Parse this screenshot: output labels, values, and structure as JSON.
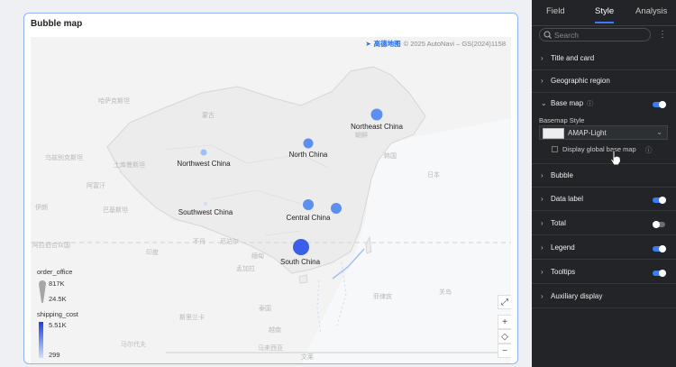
{
  "card": {
    "title": "Bubble map"
  },
  "map": {
    "credit_logo": "高德地图",
    "credit_text": "© 2025 AutoNavi – GS(2024)1158",
    "places": [
      "哈萨克斯坦",
      "哈萨克",
      "乌兹别克斯坦",
      "土库曼斯坦",
      "阿富汗",
      "伊朗",
      "巴基斯坦",
      "印度",
      "孟加拉",
      "巴勒",
      "阿拉伯合众国",
      "斯里兰卡",
      "马尔代夫",
      "蒙古",
      "朝鲜",
      "韩国",
      "日本",
      "菲律宾",
      "关岛",
      "马来西亚",
      "印度尼西亚",
      "越南",
      "泰国",
      "缅甸",
      "柬",
      "印",
      "文莱",
      "新加坡",
      "尼泊尔",
      "不丹",
      "中国台湾"
    ],
    "bubbles": [
      {
        "label": "Northeast China",
        "value": "",
        "color": "#5b8ff0"
      },
      {
        "label": "North China",
        "value": "",
        "color": "#5b8ff0"
      },
      {
        "label": "Northwest China",
        "value": "",
        "color": "#9fc0f6"
      },
      {
        "label": "Southwest China",
        "value": "",
        "color": "#cfe0fb"
      },
      {
        "label": "Central China",
        "value": "",
        "color": "#5b8ff0"
      },
      {
        "label": "South China",
        "value": "",
        "color": "#3b5fe6"
      }
    ],
    "legend": {
      "size_title": "order_office",
      "size_max": "817K",
      "size_min": "24.5K",
      "color_title": "shipping_cost",
      "color_max": "5.51K",
      "color_min": "299",
      "color_high": "#1d3fe0",
      "color_low": "#cfe0fb"
    }
  },
  "panel": {
    "tabs": [
      "Field",
      "Style",
      "Analysis"
    ],
    "active_tab": "Style",
    "search_placeholder": "Search",
    "sections": {
      "title_card": "Title and card",
      "geo_region": "Geographic region",
      "base_map": "Base map",
      "basemap_style_label": "Basemap Style",
      "basemap_style_value": "AMAP-Light",
      "global_base_map": "Display global base map",
      "bubble": "Bubble",
      "data_label": "Data label",
      "total": "Total",
      "legend": "Legend",
      "tooltips": "Tooltips",
      "aux": "Auxiliary display"
    },
    "toggles": {
      "base_map": true,
      "data_label": true,
      "total": false,
      "legend": true,
      "tooltips": true
    },
    "accent": "#3d7bf5"
  }
}
